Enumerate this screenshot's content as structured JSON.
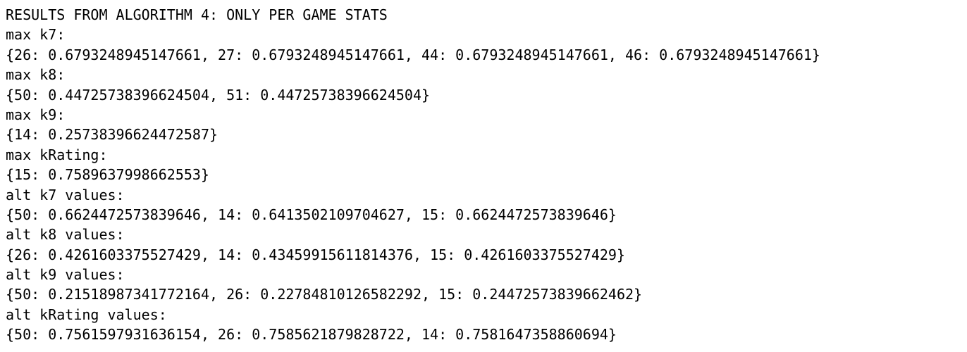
{
  "output": {
    "lines": [
      "RESULTS FROM ALGORITHM 4: ONLY PER GAME STATS",
      "max k7:",
      "{26: 0.6793248945147661, 27: 0.6793248945147661, 44: 0.6793248945147661, 46: 0.6793248945147661}",
      "max k8:",
      "{50: 0.44725738396624504, 51: 0.44725738396624504}",
      "max k9:",
      "{14: 0.25738396624472587}",
      "max kRating:",
      "{15: 0.7589637998662553}",
      "alt k7 values:",
      "{50: 0.6624472573839646, 14: 0.6413502109704627, 15: 0.6624472573839646}",
      "alt k8 values:",
      "{26: 0.4261603375527429, 14: 0.43459915611814376, 15: 0.4261603375527429}",
      "alt k9 values:",
      "{50: 0.21518987341772164, 26: 0.22784810126582292, 15: 0.24472573839662462}",
      "alt kRating values:",
      "{50: 0.7561597931636154, 26: 0.7585621879828722, 14: 0.7581647358860694}"
    ]
  },
  "colors": {
    "background": "#ffffff",
    "text": "#000000"
  }
}
